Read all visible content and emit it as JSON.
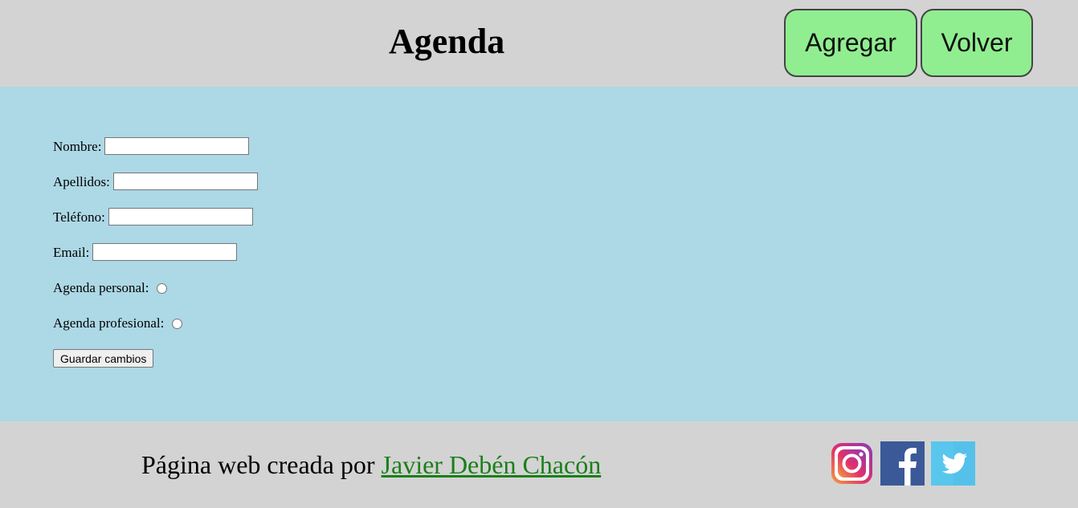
{
  "header": {
    "title": "Agenda",
    "buttons": {
      "add": "Agregar",
      "back": "Volver"
    }
  },
  "form": {
    "fields": {
      "nombre": {
        "label": "Nombre:",
        "value": ""
      },
      "apellidos": {
        "label": "Apellidos:",
        "value": ""
      },
      "telefono": {
        "label": "Teléfono:",
        "value": ""
      },
      "email": {
        "label": "Email:",
        "value": ""
      }
    },
    "radios": {
      "personal": {
        "label": "Agenda personal:",
        "checked": false
      },
      "profesional": {
        "label": "Agenda profesional:",
        "checked": false
      }
    },
    "save_label": "Guardar cambios"
  },
  "footer": {
    "text": "Página web creada por ",
    "author_link": "Javier Debén Chacón",
    "social_icons": [
      "instagram-icon",
      "facebook-icon",
      "twitter-icon"
    ]
  },
  "colors": {
    "header_bg": "#d3d3d3",
    "main_bg": "#add8e6",
    "button_bg": "#90ee90",
    "link": "#1a7f1a",
    "facebook": "#3b5998",
    "twitter": "#55c1ea"
  }
}
